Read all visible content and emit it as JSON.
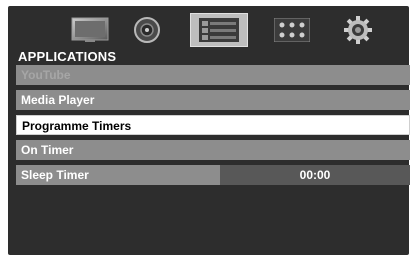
{
  "tabs": [
    {
      "icon": "picture-icon",
      "selected": false
    },
    {
      "icon": "sound-icon",
      "selected": false
    },
    {
      "icon": "applications-icon",
      "selected": true
    },
    {
      "icon": "setup-icon",
      "selected": false
    },
    {
      "icon": "settings-gear-icon",
      "selected": false
    }
  ],
  "section_title": "APPLICATIONS",
  "menu": {
    "items": [
      {
        "label": "YouTube",
        "state": "disabled"
      },
      {
        "label": "Media Player",
        "state": "normal"
      },
      {
        "label": "Programme Timers",
        "state": "selected"
      },
      {
        "label": "On Timer",
        "state": "normal"
      },
      {
        "label": "Sleep Timer",
        "state": "normal",
        "value": "00:00"
      }
    ]
  },
  "colors": {
    "screen_bg": "#2d2d2d",
    "item_bg": "#8d8d8d",
    "item_selected_bg": "#ffffff",
    "value_box_bg": "#585858"
  }
}
